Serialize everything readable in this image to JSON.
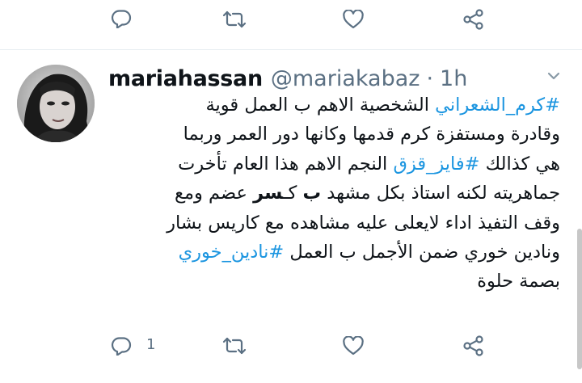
{
  "top_actions": {
    "reply_icon": "comment-icon",
    "retweet_icon": "retweet-icon",
    "like_icon": "heart-icon",
    "share_icon": "share-icon"
  },
  "tweet": {
    "display_name": "mariahassan",
    "handle": "@mariakabaz",
    "separator": "·",
    "time": "1h",
    "lines": [
      [
        {
          "text": "#كرم_الشعراني",
          "type": "hashtag"
        },
        {
          "text": " الشخصية الاهم ب العمل قوية",
          "type": "text"
        }
      ],
      [
        {
          "text": "وقادرة ومستفزة كرم قدمها وكانها دور العمر وربما",
          "type": "text"
        }
      ],
      [
        {
          "text": "هي كذالك ",
          "type": "text"
        },
        {
          "text": "#فايز_قزق",
          "type": "hashtag"
        },
        {
          "text": " النجم الاهم هذا العام تأخرت",
          "type": "text"
        }
      ],
      [
        {
          "text": "جماهريته لكنه استاذ بكل مشهد ",
          "type": "text"
        },
        {
          "text": "ب",
          "type": "bold"
        },
        {
          "text": " كـ",
          "type": "text"
        },
        {
          "text": "سر",
          "type": "bold"
        },
        {
          "text": " عضم ومع",
          "type": "text"
        }
      ],
      [
        {
          "text": "وقف التفيذ اداء لايعلى عليه مشاهده مع كاريس بشار",
          "type": "text"
        }
      ],
      [
        {
          "text": "ونادين خوري ضمن الأجمل ب العمل ",
          "type": "text"
        },
        {
          "text": "#نادين_خوري",
          "type": "hashtag"
        }
      ],
      [
        {
          "text": "بصمة حلوة",
          "type": "text"
        }
      ]
    ],
    "reply_count": "1"
  },
  "colors": {
    "hashtag": "#1b95e0",
    "secondary_text": "#5b7083",
    "primary_text": "#0f1419",
    "divider": "#e6ecf0"
  }
}
